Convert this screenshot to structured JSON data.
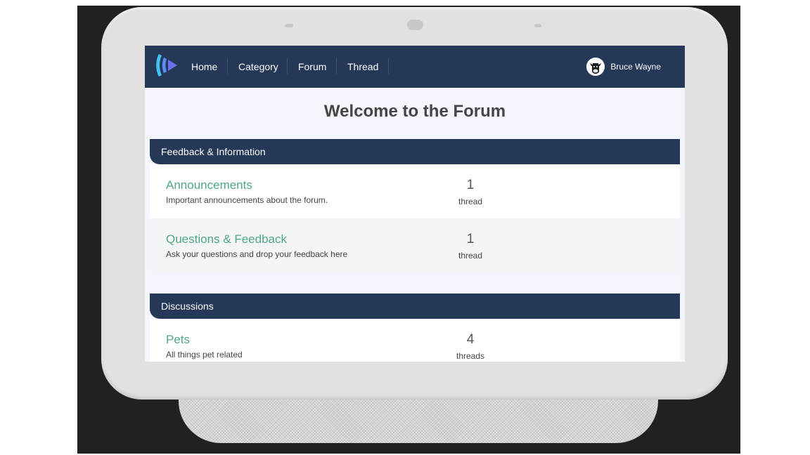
{
  "nav": {
    "links": [
      "Home",
      "Category",
      "Forum",
      "Thread"
    ]
  },
  "user": {
    "name": "Bruce Wayne"
  },
  "welcome": "Welcome to the Forum",
  "categories": [
    {
      "title": "Feedback & Information",
      "forums": [
        {
          "title": "Announcements",
          "description": "Important announcements about the forum.",
          "count": "1",
          "count_label": "thread"
        },
        {
          "title": "Questions & Feedback",
          "description": "Ask your questions and drop your feedback here",
          "count": "1",
          "count_label": "thread"
        }
      ]
    },
    {
      "title": "Discussions",
      "forums": [
        {
          "title": "Pets",
          "description": "All things pet related",
          "count": "4",
          "count_label": "threads"
        }
      ]
    }
  ],
  "colors": {
    "nav_bg": "#263858",
    "forum_link": "#50a882",
    "page_bg": "#f3f7fd"
  },
  "icons": {
    "logo": "forum-logo-icon",
    "avatar": "cow-avatar-icon"
  }
}
